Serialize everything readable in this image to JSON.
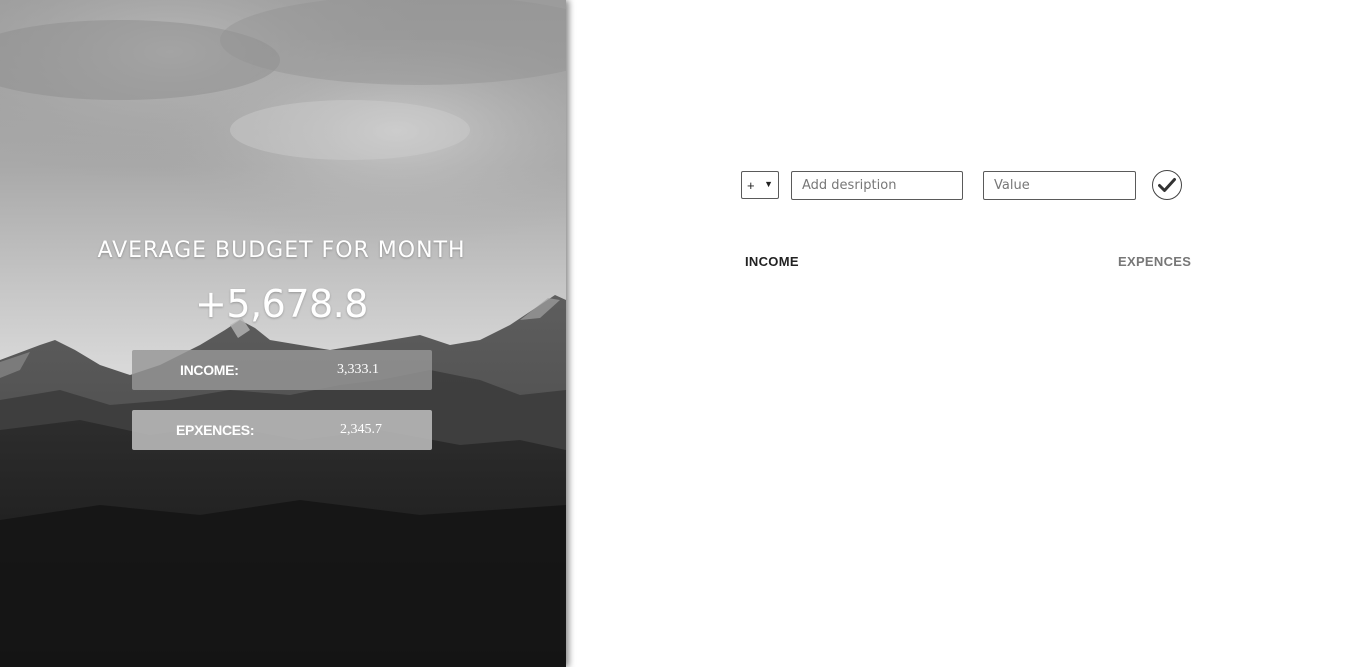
{
  "summary": {
    "title": "AVERAGE BUDGET FOR MONTH",
    "total": "+5,678.8",
    "income_label": "INCOME:",
    "income_value": "3,333.1",
    "expenses_label": "EPXENCES:",
    "expenses_value": "2,345.7"
  },
  "form": {
    "type_value": "+",
    "type_options": [
      "+"
    ],
    "description_placeholder": "Add desription",
    "value_placeholder": "Value",
    "submit_icon": "checkmark-icon"
  },
  "lists": {
    "income_title": "INCOME",
    "expenses_title": "EXPENCES"
  }
}
